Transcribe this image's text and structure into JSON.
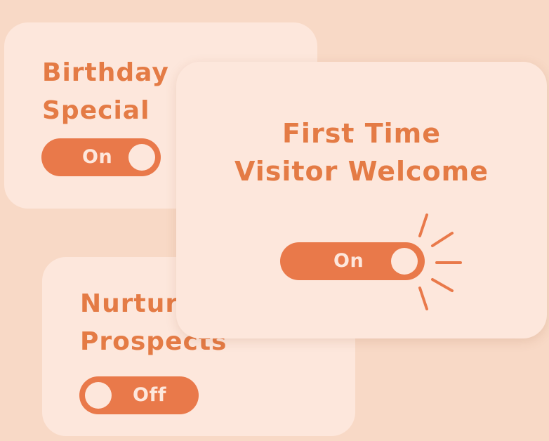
{
  "cards": {
    "birthday": {
      "title": "Birthday\nSpecial",
      "toggle_label": "On"
    },
    "nurture": {
      "title": "Nurture\nProspects",
      "toggle_label": "Off"
    },
    "welcome": {
      "title": "First Time\nVisitor Welcome",
      "toggle_label": "On"
    }
  },
  "icons": {
    "click_effect": "click-rays-icon"
  },
  "colors": {
    "background": "#f8d9c6",
    "card": "#fde7dc",
    "accent": "#e9794a"
  }
}
